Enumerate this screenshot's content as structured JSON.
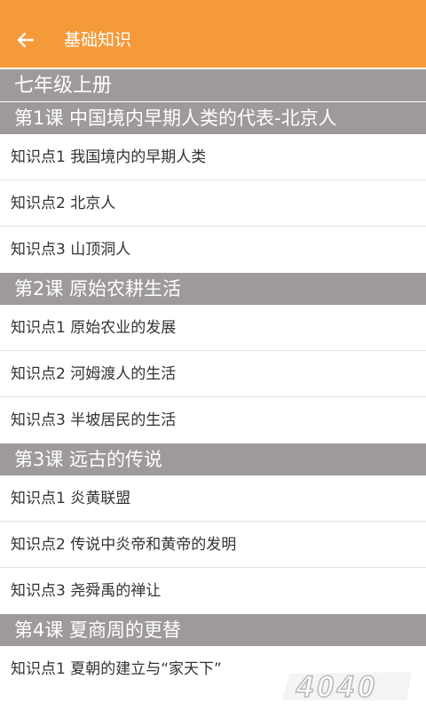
{
  "header": {
    "title": "基础知识",
    "back_icon": "arrow-left-icon",
    "background": "#f59a3a"
  },
  "grade": "七年级上册",
  "lessons": [
    {
      "title": "第1课 中国境内早期人类的代表-北京人",
      "points": [
        "知识点1 我国境内的早期人类",
        "知识点2 北京人",
        "知识点3 山顶洞人"
      ]
    },
    {
      "title": "第2课 原始农耕生活",
      "points": [
        "知识点1 原始农业的发展",
        "知识点2 河姆渡人的生活",
        "知识点3 半坡居民的生活"
      ]
    },
    {
      "title": "第3课 远古的传说",
      "points": [
        "知识点1 炎黄联盟",
        "知识点2 传说中炎帝和黄帝的发明",
        "知识点3 尧舜禹的禅让"
      ]
    },
    {
      "title": "第4课 夏商周的更替",
      "points": [
        "知识点1 夏朝的建立与“家天下”"
      ]
    }
  ],
  "watermark": {
    "text": "4040"
  },
  "colors": {
    "section_header": "#9e9a99",
    "divider": "#e2e2e2"
  }
}
